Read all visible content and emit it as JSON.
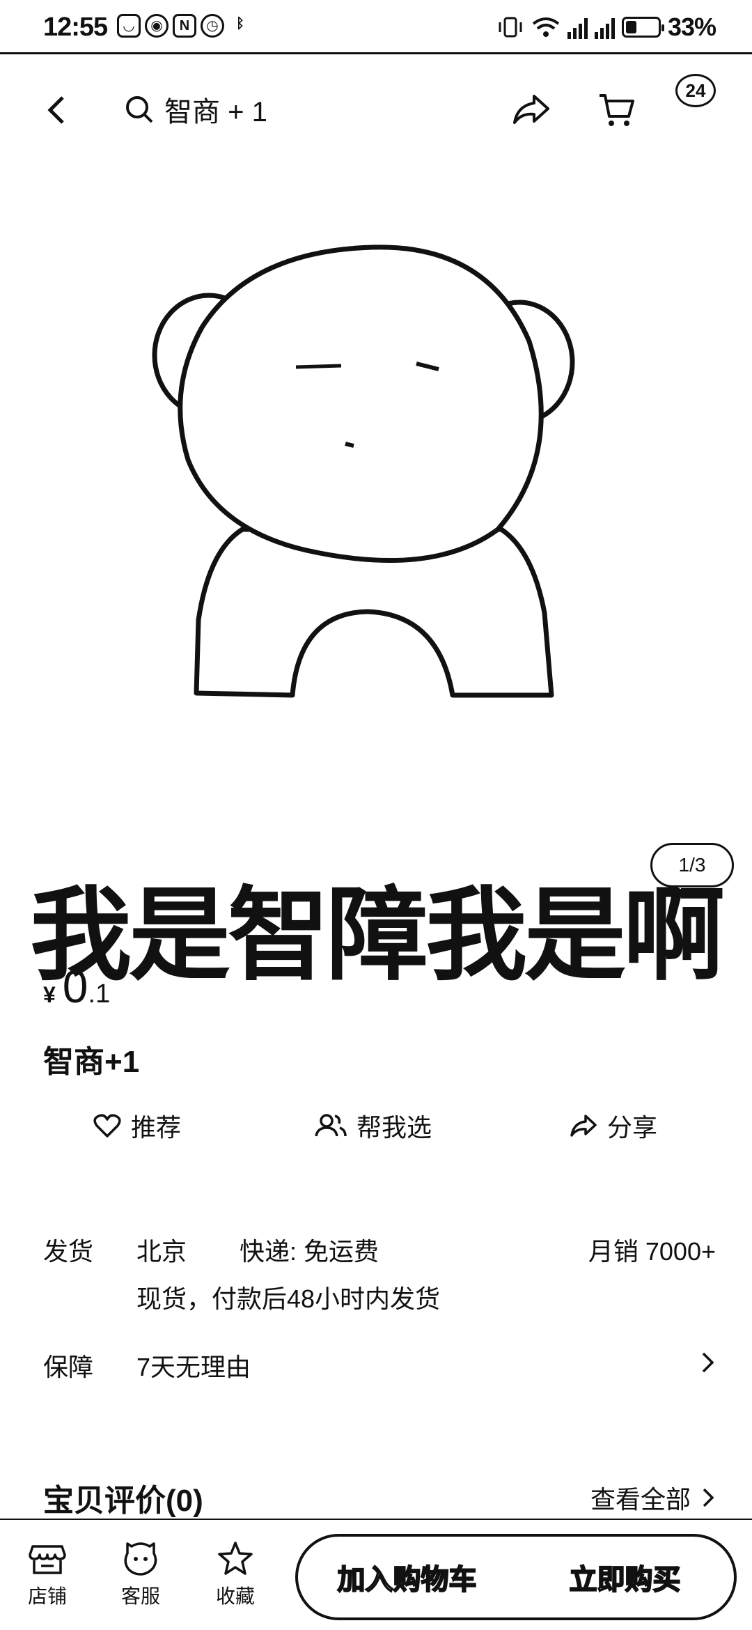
{
  "status_bar": {
    "time": "12:55",
    "battery": "33%",
    "battery_level": 0.33
  },
  "nav": {
    "search_text": "智商 + 1",
    "message_count": "24"
  },
  "hero": {
    "caption": "我是智障我是啊",
    "counter": "1/3"
  },
  "product": {
    "price_symbol": "¥",
    "price_int": "0",
    "price_dec": ".1",
    "title": "智商+1"
  },
  "actions": {
    "recommend": "推荐",
    "help_choose": "帮我选",
    "share": "分享"
  },
  "shipping": {
    "label": "发货",
    "from": "北京",
    "method": "快递: 免运费",
    "sales": "月销  7000+",
    "note": "现货，付款后48小时内发货"
  },
  "guarantee": {
    "label": "保障",
    "value": "7天无理由"
  },
  "reviews": {
    "title": "宝贝评价(0)",
    "view_all": "查看全部"
  },
  "bottom_bar": {
    "shop": "店铺",
    "service": "客服",
    "favorite": "收藏",
    "add_to_cart": "加入购物车",
    "buy_now": "立即购买"
  }
}
